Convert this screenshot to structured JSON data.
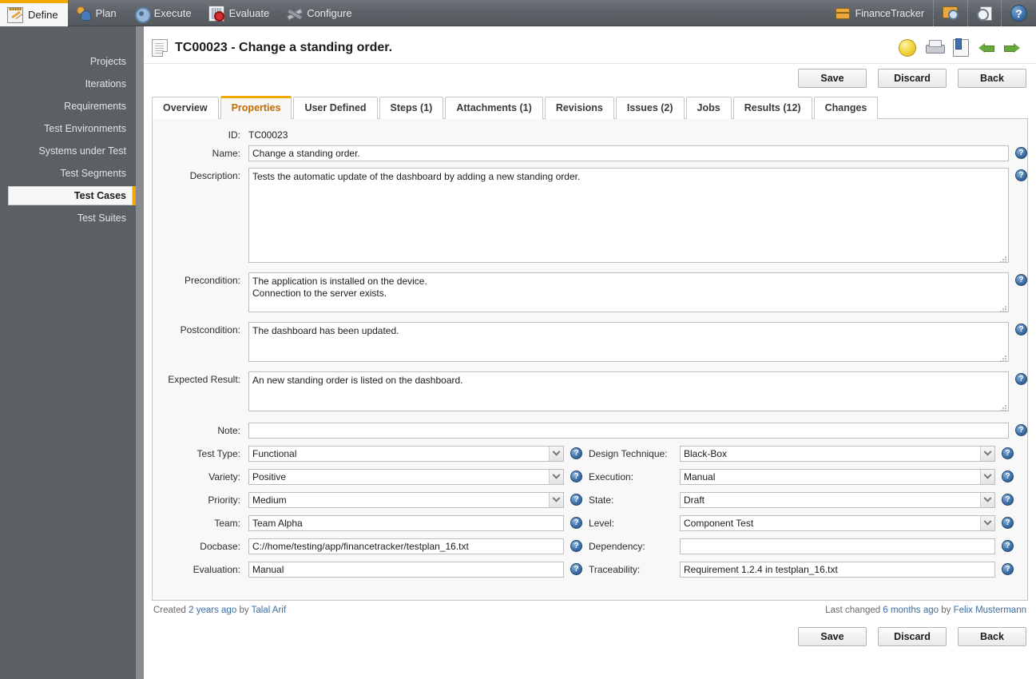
{
  "topnav": {
    "tabs": [
      {
        "label": "Define",
        "icon": "notepad-icon",
        "active": true
      },
      {
        "label": "Plan",
        "icon": "people-icon",
        "active": false
      },
      {
        "label": "Execute",
        "icon": "gear-icon",
        "active": false
      },
      {
        "label": "Evaluate",
        "icon": "chart-doc-icon",
        "active": false
      },
      {
        "label": "Configure",
        "icon": "tools-icon",
        "active": false
      }
    ],
    "project": "FinanceTracker",
    "right_icons": [
      "project-chest-icon",
      "chest-search-icon",
      "recent-clock-doc-icon",
      "help-icon"
    ]
  },
  "sidebar": {
    "items": [
      {
        "label": "Projects",
        "active": false
      },
      {
        "label": "Iterations",
        "active": false
      },
      {
        "label": "Requirements",
        "active": false
      },
      {
        "label": "Test Environments",
        "active": false
      },
      {
        "label": "Systems under Test",
        "active": false
      },
      {
        "label": "Test Segments",
        "active": false
      },
      {
        "label": "Test Cases",
        "active": true
      },
      {
        "label": "Test Suites",
        "active": false
      }
    ]
  },
  "header": {
    "title": "TC00023 - Change a standing order.",
    "icons": [
      "lamp-icon",
      "print-icon",
      "report-icon",
      "previous-arrow-icon",
      "next-arrow-icon"
    ]
  },
  "buttons": {
    "save": "Save",
    "discard": "Discard",
    "back": "Back"
  },
  "tabs": [
    {
      "label": "Overview",
      "active": false
    },
    {
      "label": "Properties",
      "active": true
    },
    {
      "label": "User Defined",
      "active": false
    },
    {
      "label": "Steps (1)",
      "active": false
    },
    {
      "label": "Attachments (1)",
      "active": false
    },
    {
      "label": "Revisions",
      "active": false
    },
    {
      "label": "Issues (2)",
      "active": false
    },
    {
      "label": "Jobs",
      "active": false
    },
    {
      "label": "Results (12)",
      "active": false
    },
    {
      "label": "Changes",
      "active": false
    }
  ],
  "form": {
    "id": {
      "label": "ID:",
      "value": "TC00023"
    },
    "name": {
      "label": "Name:",
      "value": "Change a standing order."
    },
    "description": {
      "label": "Description:",
      "value": "Tests the automatic update of the dashboard by adding a new standing order."
    },
    "precondition": {
      "label": "Precondition:",
      "value": "The application is installed on the device.\nConnection to the server exists."
    },
    "postcondition": {
      "label": "Postcondition:",
      "value": "The dashboard has been updated."
    },
    "expected_result": {
      "label": "Expected Result:",
      "value": "An new standing order is listed on the dashboard."
    },
    "note": {
      "label": "Note:",
      "value": ""
    },
    "test_type": {
      "label": "Test Type:",
      "value": "Functional",
      "type": "select"
    },
    "variety": {
      "label": "Variety:",
      "value": "Positive",
      "type": "select"
    },
    "priority": {
      "label": "Priority:",
      "value": "Medium",
      "type": "select"
    },
    "team": {
      "label": "Team:",
      "value": "Team Alpha",
      "type": "text"
    },
    "docbase": {
      "label": "Docbase:",
      "value": "C://home/testing/app/financetracker/testplan_16.txt",
      "type": "text"
    },
    "evaluation": {
      "label": "Evaluation:",
      "value": "Manual",
      "type": "text"
    },
    "design_technique": {
      "label": "Design Technique:",
      "value": "Black-Box",
      "type": "select"
    },
    "execution": {
      "label": "Execution:",
      "value": "Manual",
      "type": "select"
    },
    "state": {
      "label": "State:",
      "value": "Draft",
      "type": "select"
    },
    "level": {
      "label": "Level:",
      "value": "Component Test",
      "type": "select"
    },
    "dependency": {
      "label": "Dependency:",
      "value": "",
      "type": "text"
    },
    "traceability": {
      "label": "Traceability:",
      "value": "Requirement 1.2.4 in testplan_16.txt",
      "type": "text"
    },
    "help_glyph": "?"
  },
  "meta": {
    "created_prefix": "Created",
    "created_time": "2 years ago",
    "created_by_word": "by",
    "created_by": "Talal Arif",
    "changed_prefix": "Last changed",
    "changed_time": "6 months ago",
    "changed_by_word": "by",
    "changed_by": "Felix Mustermann"
  },
  "colors": {
    "accent": "#f2a900",
    "nav_bg": "#5b6166",
    "sidebar_bg": "#5b6065",
    "link": "#3a6ea5",
    "tab_active_text": "#c26c00"
  }
}
